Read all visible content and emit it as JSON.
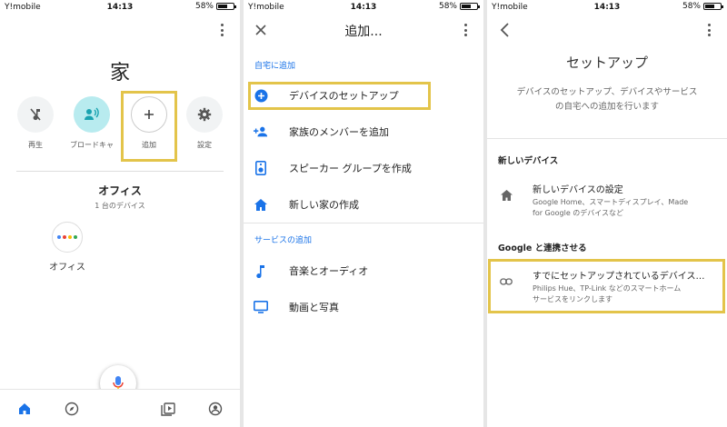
{
  "status": {
    "carrier": "Y!mobile",
    "time": "14:13",
    "battery": "58%"
  },
  "screen1": {
    "home_title": "家",
    "actions": [
      {
        "label": "再生"
      },
      {
        "label": "ブロードキャ"
      },
      {
        "label": "追加"
      },
      {
        "label": "設定"
      }
    ],
    "room_name": "オフィス",
    "room_count": "1 台のデバイス",
    "device_name": "オフィス"
  },
  "screen2": {
    "title": "追加...",
    "section_home": "自宅に追加",
    "items_home": [
      {
        "label": "デバイスのセットアップ",
        "icon": "plus-circle-icon"
      },
      {
        "label": "家族のメンバーを追加",
        "icon": "person-add-icon"
      },
      {
        "label": "スピーカー グループを作成",
        "icon": "speaker-icon"
      },
      {
        "label": "新しい家の作成",
        "icon": "home-icon"
      }
    ],
    "section_services": "サービスの追加",
    "items_services": [
      {
        "label": "音楽とオーディオ",
        "icon": "music-note-icon"
      },
      {
        "label": "動画と写真",
        "icon": "tv-icon"
      }
    ]
  },
  "screen3": {
    "title": "セットアップ",
    "description_line1": "デバイスのセットアップ、デバイスやサービス",
    "description_line2": "の自宅への追加を行います",
    "section_new": "新しいデバイス",
    "new_device": {
      "title": "新しいデバイスの設定",
      "sub_line1": "Google Home、スマートディスプレイ、Made",
      "sub_line2": "for Google のデバイスなど"
    },
    "section_link": "Google と連携させる",
    "link_device": {
      "title": "すでにセットアップされているデバイス…",
      "sub_line1": "Philips Hue、TP-Link などのスマートホーム",
      "sub_line2": "サービスをリンクします"
    }
  },
  "colors": {
    "accent": "#1a73e8",
    "highlight": "#e3c44a",
    "teal": "#b8ebef"
  }
}
